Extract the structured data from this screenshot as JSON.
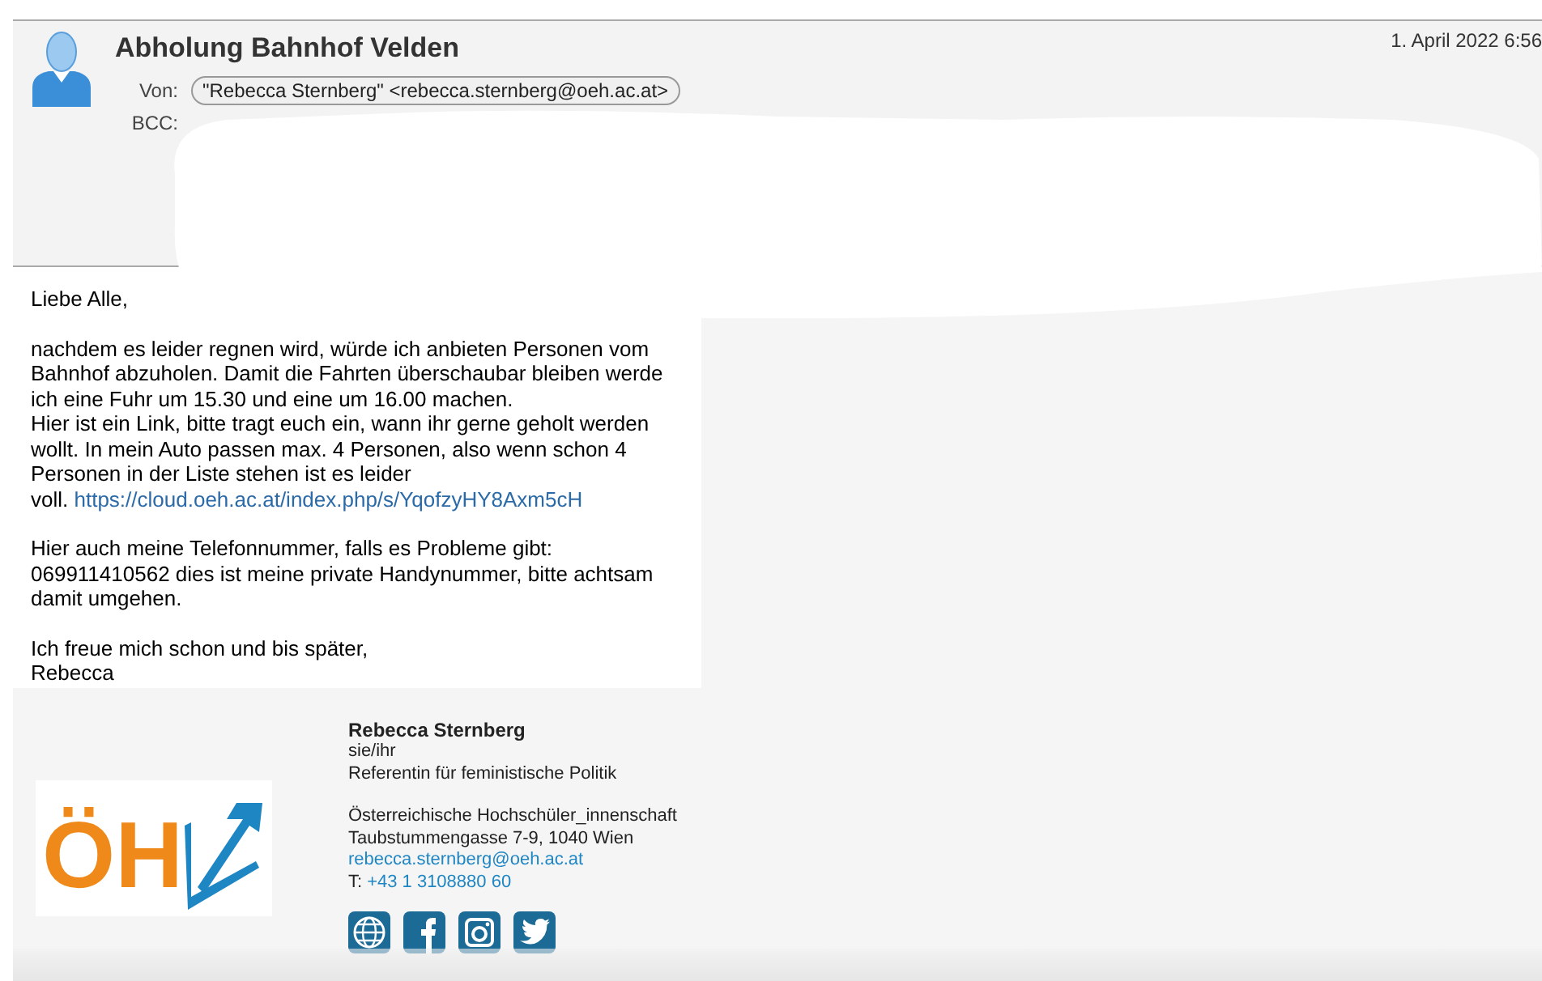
{
  "message": {
    "subject": "Abholung Bahnhof Velden",
    "date": "1. April 2022 6:56",
    "fields": [
      {
        "label": "Von:",
        "value": "\"Rebecca Sternberg\" <rebecca.sternberg@oeh.ac.at>"
      },
      {
        "label": "BCC:"
      }
    ]
  },
  "body": [
    {
      "lines": [
        "Liebe Alle,"
      ]
    },
    {
      "lines": [
        "nachdem es leider regnen wird, würde ich anbieten Personen vom",
        "Bahnhof abzuholen. Damit die Fahrten überschaubar bleiben werde",
        "ich eine Fuhr um 15.30 und eine um 16.00 machen.",
        "Hier ist ein Link, bitte tragt euch ein, wann ihr gerne geholt werden",
        "wollt. In mein Auto passen max. 4 Personen, also wenn schon 4",
        "Personen in der Liste stehen ist es leider",
        "voll."
      ],
      "link": "https://cloud.oeh.ac.at/index.php/s/YqofzyHY8Axm5cH"
    },
    {
      "lines": [
        "Hier auch meine Telefonnummer, falls es Probleme gibt:",
        "069911410562 dies ist meine private Handynummer, bitte achtsam",
        "damit umgehen."
      ]
    },
    {
      "lines": [
        "Ich freue mich schon und bis später,",
        "Rebecca"
      ]
    }
  ],
  "signature": {
    "logo_text": "ÖH",
    "name": "Rebecca Sternberg",
    "pronouns": "sie/ihr",
    "role": "Referentin für feministische Politik",
    "organisation": "Österreichische Hochschüler_innenschaft",
    "address": "Taubstummengasse 7-9, 1040 Wien",
    "email": "rebecca.sternberg@oeh.ac.at",
    "phone_label": "T:",
    "phone": "+43 1 3108880 60",
    "social": [
      {
        "kind": "web"
      },
      {
        "kind": "facebook"
      },
      {
        "kind": "instagram"
      },
      {
        "kind": "twitter"
      }
    ]
  }
}
